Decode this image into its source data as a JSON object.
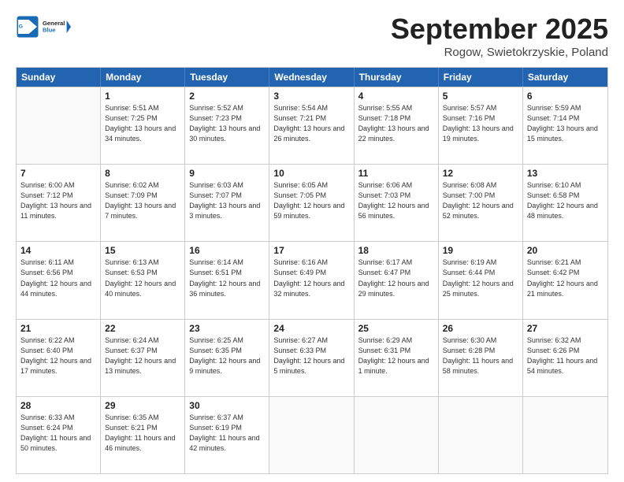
{
  "logo": {
    "line1": "General",
    "line2": "Blue"
  },
  "title": "September 2025",
  "location": "Rogow, Swietokrzyskie, Poland",
  "header_days": [
    "Sunday",
    "Monday",
    "Tuesday",
    "Wednesday",
    "Thursday",
    "Friday",
    "Saturday"
  ],
  "weeks": [
    [
      {
        "day": "",
        "sunrise": "",
        "sunset": "",
        "daylight": ""
      },
      {
        "day": "1",
        "sunrise": "Sunrise: 5:51 AM",
        "sunset": "Sunset: 7:25 PM",
        "daylight": "Daylight: 13 hours and 34 minutes."
      },
      {
        "day": "2",
        "sunrise": "Sunrise: 5:52 AM",
        "sunset": "Sunset: 7:23 PM",
        "daylight": "Daylight: 13 hours and 30 minutes."
      },
      {
        "day": "3",
        "sunrise": "Sunrise: 5:54 AM",
        "sunset": "Sunset: 7:21 PM",
        "daylight": "Daylight: 13 hours and 26 minutes."
      },
      {
        "day": "4",
        "sunrise": "Sunrise: 5:55 AM",
        "sunset": "Sunset: 7:18 PM",
        "daylight": "Daylight: 13 hours and 22 minutes."
      },
      {
        "day": "5",
        "sunrise": "Sunrise: 5:57 AM",
        "sunset": "Sunset: 7:16 PM",
        "daylight": "Daylight: 13 hours and 19 minutes."
      },
      {
        "day": "6",
        "sunrise": "Sunrise: 5:59 AM",
        "sunset": "Sunset: 7:14 PM",
        "daylight": "Daylight: 13 hours and 15 minutes."
      }
    ],
    [
      {
        "day": "7",
        "sunrise": "Sunrise: 6:00 AM",
        "sunset": "Sunset: 7:12 PM",
        "daylight": "Daylight: 13 hours and 11 minutes."
      },
      {
        "day": "8",
        "sunrise": "Sunrise: 6:02 AM",
        "sunset": "Sunset: 7:09 PM",
        "daylight": "Daylight: 13 hours and 7 minutes."
      },
      {
        "day": "9",
        "sunrise": "Sunrise: 6:03 AM",
        "sunset": "Sunset: 7:07 PM",
        "daylight": "Daylight: 13 hours and 3 minutes."
      },
      {
        "day": "10",
        "sunrise": "Sunrise: 6:05 AM",
        "sunset": "Sunset: 7:05 PM",
        "daylight": "Daylight: 12 hours and 59 minutes."
      },
      {
        "day": "11",
        "sunrise": "Sunrise: 6:06 AM",
        "sunset": "Sunset: 7:03 PM",
        "daylight": "Daylight: 12 hours and 56 minutes."
      },
      {
        "day": "12",
        "sunrise": "Sunrise: 6:08 AM",
        "sunset": "Sunset: 7:00 PM",
        "daylight": "Daylight: 12 hours and 52 minutes."
      },
      {
        "day": "13",
        "sunrise": "Sunrise: 6:10 AM",
        "sunset": "Sunset: 6:58 PM",
        "daylight": "Daylight: 12 hours and 48 minutes."
      }
    ],
    [
      {
        "day": "14",
        "sunrise": "Sunrise: 6:11 AM",
        "sunset": "Sunset: 6:56 PM",
        "daylight": "Daylight: 12 hours and 44 minutes."
      },
      {
        "day": "15",
        "sunrise": "Sunrise: 6:13 AM",
        "sunset": "Sunset: 6:53 PM",
        "daylight": "Daylight: 12 hours and 40 minutes."
      },
      {
        "day": "16",
        "sunrise": "Sunrise: 6:14 AM",
        "sunset": "Sunset: 6:51 PM",
        "daylight": "Daylight: 12 hours and 36 minutes."
      },
      {
        "day": "17",
        "sunrise": "Sunrise: 6:16 AM",
        "sunset": "Sunset: 6:49 PM",
        "daylight": "Daylight: 12 hours and 32 minutes."
      },
      {
        "day": "18",
        "sunrise": "Sunrise: 6:17 AM",
        "sunset": "Sunset: 6:47 PM",
        "daylight": "Daylight: 12 hours and 29 minutes."
      },
      {
        "day": "19",
        "sunrise": "Sunrise: 6:19 AM",
        "sunset": "Sunset: 6:44 PM",
        "daylight": "Daylight: 12 hours and 25 minutes."
      },
      {
        "day": "20",
        "sunrise": "Sunrise: 6:21 AM",
        "sunset": "Sunset: 6:42 PM",
        "daylight": "Daylight: 12 hours and 21 minutes."
      }
    ],
    [
      {
        "day": "21",
        "sunrise": "Sunrise: 6:22 AM",
        "sunset": "Sunset: 6:40 PM",
        "daylight": "Daylight: 12 hours and 17 minutes."
      },
      {
        "day": "22",
        "sunrise": "Sunrise: 6:24 AM",
        "sunset": "Sunset: 6:37 PM",
        "daylight": "Daylight: 12 hours and 13 minutes."
      },
      {
        "day": "23",
        "sunrise": "Sunrise: 6:25 AM",
        "sunset": "Sunset: 6:35 PM",
        "daylight": "Daylight: 12 hours and 9 minutes."
      },
      {
        "day": "24",
        "sunrise": "Sunrise: 6:27 AM",
        "sunset": "Sunset: 6:33 PM",
        "daylight": "Daylight: 12 hours and 5 minutes."
      },
      {
        "day": "25",
        "sunrise": "Sunrise: 6:29 AM",
        "sunset": "Sunset: 6:31 PM",
        "daylight": "Daylight: 12 hours and 1 minute."
      },
      {
        "day": "26",
        "sunrise": "Sunrise: 6:30 AM",
        "sunset": "Sunset: 6:28 PM",
        "daylight": "Daylight: 11 hours and 58 minutes."
      },
      {
        "day": "27",
        "sunrise": "Sunrise: 6:32 AM",
        "sunset": "Sunset: 6:26 PM",
        "daylight": "Daylight: 11 hours and 54 minutes."
      }
    ],
    [
      {
        "day": "28",
        "sunrise": "Sunrise: 6:33 AM",
        "sunset": "Sunset: 6:24 PM",
        "daylight": "Daylight: 11 hours and 50 minutes."
      },
      {
        "day": "29",
        "sunrise": "Sunrise: 6:35 AM",
        "sunset": "Sunset: 6:21 PM",
        "daylight": "Daylight: 11 hours and 46 minutes."
      },
      {
        "day": "30",
        "sunrise": "Sunrise: 6:37 AM",
        "sunset": "Sunset: 6:19 PM",
        "daylight": "Daylight: 11 hours and 42 minutes."
      },
      {
        "day": "",
        "sunrise": "",
        "sunset": "",
        "daylight": ""
      },
      {
        "day": "",
        "sunrise": "",
        "sunset": "",
        "daylight": ""
      },
      {
        "day": "",
        "sunrise": "",
        "sunset": "",
        "daylight": ""
      },
      {
        "day": "",
        "sunrise": "",
        "sunset": "",
        "daylight": ""
      }
    ]
  ]
}
